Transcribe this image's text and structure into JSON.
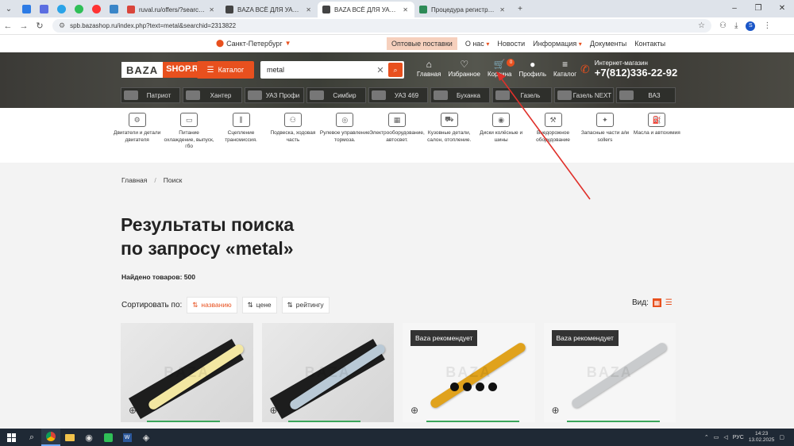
{
  "browser": {
    "tabs": [
      {
        "label": "ruval.ru/offers/?search_searchi",
        "active": false,
        "color": "#d9453b"
      },
      {
        "label": "BAZA ВСЁ ДЛЯ УАЗА – Интерн",
        "active": false,
        "color": "#444"
      },
      {
        "label": "BAZA ВСЁ ДЛЯ УАЗА – Интерн",
        "active": true,
        "color": "#444"
      },
      {
        "label": "Процедура регистрации на са",
        "active": false,
        "color": "#2e8b57"
      }
    ],
    "new_tab": "+",
    "url": "spb.bazashop.ru/index.php?text=metal&searchid=2313822",
    "profile_initial": "S"
  },
  "topbar": {
    "city": "Санкт-Петербург",
    "links": [
      "Оптовые поставки",
      "О нас",
      "Новости",
      "Информация",
      "Документы",
      "Контакты"
    ]
  },
  "header": {
    "logo_left": "BAZA",
    "logo_right": "SHOP.RU",
    "catalog_button": "Каталог",
    "search_value": "metal",
    "icons": [
      {
        "label": "Главная",
        "glyph": "⌂"
      },
      {
        "label": "Избранное",
        "glyph": "♡"
      },
      {
        "label": "Корзина",
        "glyph": "🛒",
        "badge": "0"
      },
      {
        "label": "Профиль",
        "glyph": "●"
      },
      {
        "label": "Каталог",
        "glyph": "≡"
      }
    ],
    "phone_label": "Интернет-магазин",
    "phone": "+7(812)336-22-92"
  },
  "models": [
    "Патриот",
    "Хантер",
    "УАЗ Профи",
    "Симбир",
    "УАЗ 469",
    "Буханка",
    "Газель",
    "Газель NEXT",
    "ВАЗ"
  ],
  "categories": [
    "Двигатели и детали двигателя",
    "Питание охлаждение, выпуск, гбо",
    "Сцепление трансмиссия.",
    "Подвеска, ходовая часть",
    "Рулевое управление тормоза.",
    "Электрооборудование, автосвет.",
    "Кузовные детали, салон, отопление.",
    "Диски колёсные и шины",
    "Внедорожное оборудование",
    "Запасные части а/м sollers",
    "Масла и автохимия"
  ],
  "breadcrumbs": [
    "Главная",
    "Поиск"
  ],
  "page": {
    "title_line1": "Результаты поиска",
    "title_line2": "по запросу «metal»",
    "found": "Найдено товаров: 500"
  },
  "sort": {
    "label": "Сортировать по:",
    "options": [
      "названию",
      "цене",
      "рейтингу"
    ],
    "view_label": "Вид:"
  },
  "cards": [
    {
      "badge": "",
      "shock_color": "#f3e7a2"
    },
    {
      "badge": "",
      "shock_color": "#b9c9d6"
    },
    {
      "badge": "Baza рекомендует",
      "shock_color": "#e0a21c"
    },
    {
      "badge": "Baza рекомендует",
      "shock_color": "#c9cbcd"
    }
  ],
  "taskbar": {
    "lang": "РУС",
    "time": "14:23",
    "date": "13.02.2025"
  }
}
